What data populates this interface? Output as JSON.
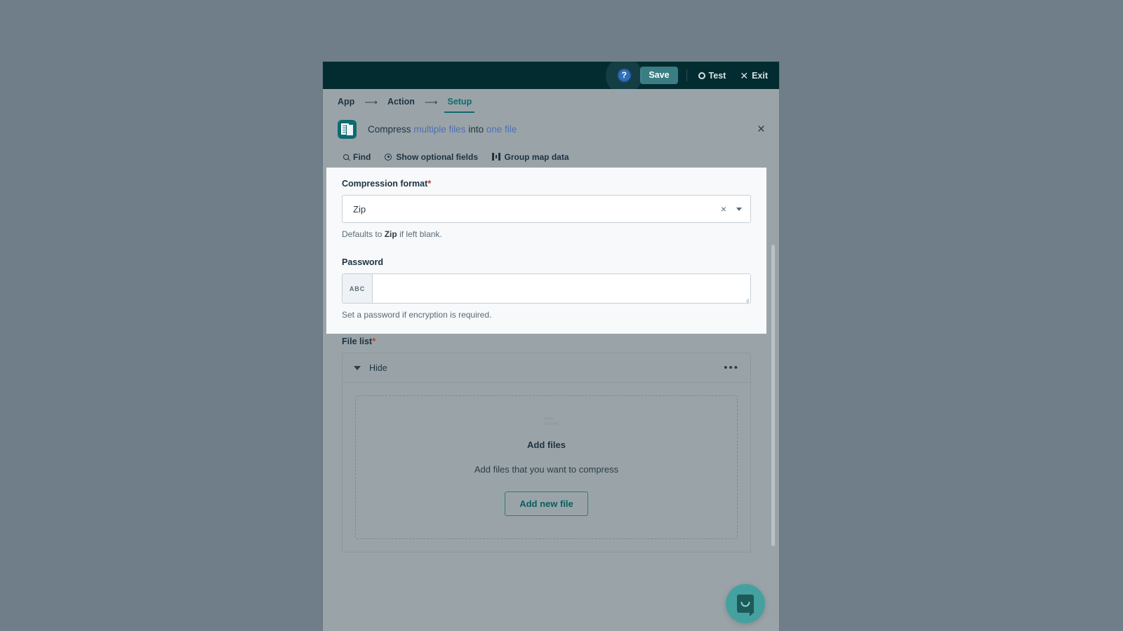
{
  "topbar": {
    "help_icon": "help-circle-icon",
    "help_label": "?",
    "save_label": "Save",
    "test_label": "Test",
    "exit_label": "Exit"
  },
  "breadcrumb": {
    "items": [
      {
        "label": "App",
        "active": false
      },
      {
        "label": "Action",
        "active": false
      },
      {
        "label": "Setup",
        "active": true
      }
    ],
    "separator": "⟶"
  },
  "action_header": {
    "icon": "compress-files-icon",
    "title_prefix": "Compress",
    "title_var1": "multiple files",
    "title_mid": "into",
    "title_var2": "one file",
    "close_label": "×"
  },
  "subtoolbar": {
    "find_label": "Find",
    "show_optional_label": "Show optional fields",
    "group_map_label": "Group map data"
  },
  "form": {
    "compression_format": {
      "label": "Compression format",
      "required_marker": "*",
      "value": "Zip",
      "clear_label": "×",
      "helper_prefix": "Defaults to",
      "helper_bold": "Zip",
      "helper_suffix": "if left blank."
    },
    "password": {
      "label": "Password",
      "prefix_badge": "ABC",
      "value": "",
      "placeholder": "",
      "helper": "Set a password if encryption is required."
    },
    "file_list": {
      "label": "File list",
      "required_marker": "*",
      "toggle_label": "Hide",
      "menu_label": "•••",
      "dropzone": {
        "title": "Add files",
        "subtitle": "Add files that you want to compress",
        "button_label": "Add new file"
      }
    }
  },
  "widgets": {
    "intercom_label": "chat-launcher"
  },
  "colors": {
    "backdrop": "#6f7e88",
    "topbar": "#032c31",
    "accent_teal": "#0f6a6f",
    "save_button": "#3a7d82",
    "panel": "#f7f9fb",
    "modal_body": "#9aa4a8",
    "required_red": "#c0392b",
    "variable_blue": "#4e6fb5",
    "intercom": "#45a1a0"
  }
}
